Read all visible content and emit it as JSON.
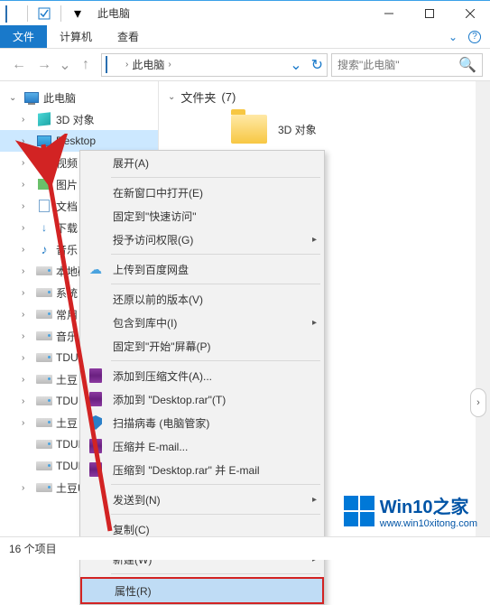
{
  "title": "此电脑",
  "ribbon": {
    "file": "文件",
    "computer": "计算机",
    "view": "查看"
  },
  "breadcrumb": {
    "location": "此电脑"
  },
  "search": {
    "placeholder": "搜索\"此电脑\""
  },
  "tree": {
    "root": "此电脑",
    "items": [
      "3D 对象",
      "Desktop",
      "视频",
      "图片",
      "文档",
      "下载",
      "音乐",
      "本地磁盘",
      "系统",
      "常用",
      "音乐",
      "TDU",
      "土豆",
      "TDU",
      "土豆",
      "TDUP",
      "TDUP",
      "土豆U"
    ]
  },
  "main": {
    "section": "文件夹",
    "count": "(7)",
    "folder1": "3D 对象"
  },
  "ctx": {
    "expand": "展开(A)",
    "open_new": "在新窗口中打开(E)",
    "pin_quick": "固定到\"快速访问\"",
    "grant_access": "授予访问权限(G)",
    "baidu": "上传到百度网盘",
    "restore": "还原以前的版本(V)",
    "include_lib": "包含到库中(I)",
    "pin_start": "固定到\"开始\"屏幕(P)",
    "rar_add": "添加到压缩文件(A)...",
    "rar_add_to": "添加到 \"Desktop.rar\"(T)",
    "scan": "扫描病毒 (电脑管家)",
    "rar_email": "压缩并 E-mail...",
    "rar_email_to": "压缩到 \"Desktop.rar\" 并 E-mail",
    "send_to": "发送到(N)",
    "copy": "复制(C)",
    "new": "新建(W)",
    "props": "属性(R)"
  },
  "status": "16 个项目",
  "watermark": {
    "title": "Win10之家",
    "url": "www.win10xitong.com"
  }
}
